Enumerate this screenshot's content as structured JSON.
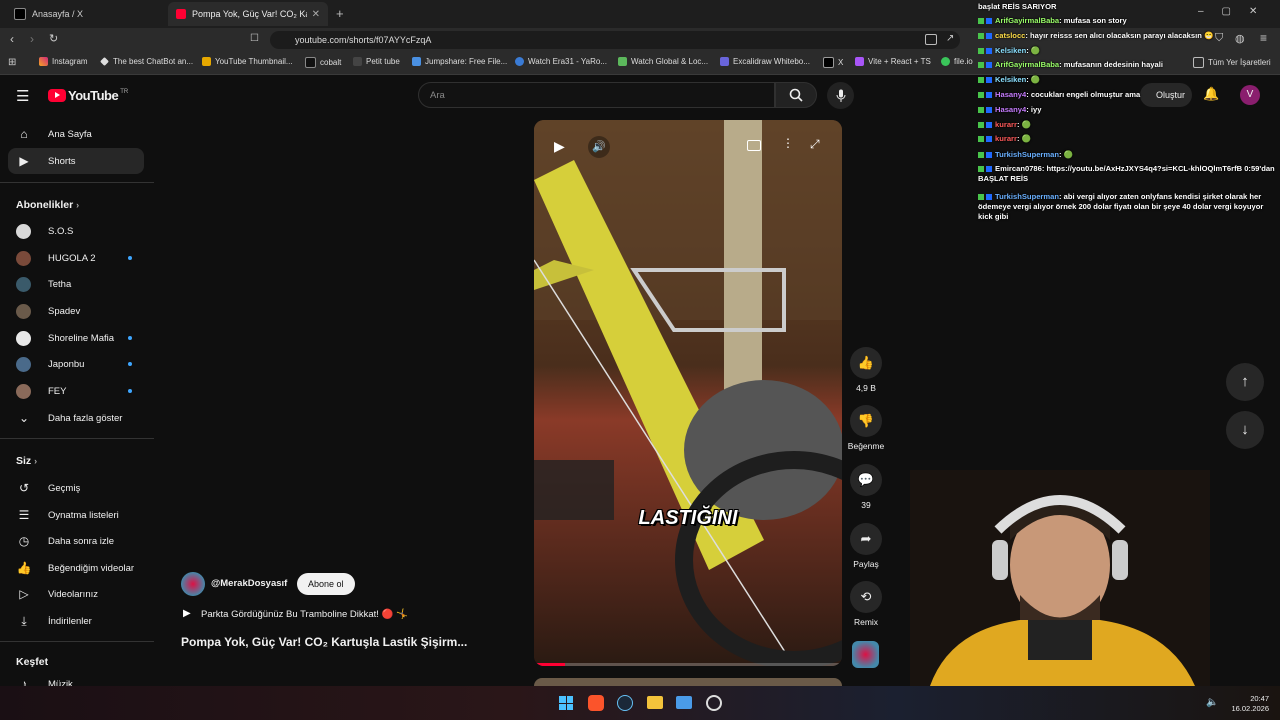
{
  "browser": {
    "tabs": [
      {
        "title": "Anasayfa / X"
      },
      {
        "title": "Pompa Yok, Güç Var! CO₂ Kart"
      }
    ],
    "url": "youtube.com/shorts/f07AYYcFzqA",
    "bookmarks": [
      "Instagram",
      "The best ChatBot an...",
      "YouTube Thumbnail...",
      "cobalt",
      "Petit tube",
      "Jumpshare: Free File...",
      "Watch Era31 - YaRo...",
      "Watch Global & Loc...",
      "Excalidraw Whitebo...",
      "X",
      "Vite + React + TS",
      "file.io"
    ],
    "bookmarks_all": "Tüm Yer İşaretleri"
  },
  "youtube": {
    "logo": "YouTube",
    "logo_region": "TR",
    "search_placeholder": "Ara",
    "create_label": "Oluştur",
    "avatar_letter": "V",
    "sidebar": {
      "main": [
        {
          "label": "Ana Sayfa",
          "icon": "home-icon"
        },
        {
          "label": "Shorts",
          "icon": "shorts-icon"
        }
      ],
      "subs_heading": "Abonelikler",
      "subs": [
        {
          "label": "S.O.S",
          "dot": false,
          "color": "#d8d8d8"
        },
        {
          "label": "HUGOLA 2",
          "dot": true,
          "color": "#7a4a3a"
        },
        {
          "label": "Tetha",
          "dot": false,
          "color": "#3a5a6a"
        },
        {
          "label": "Spadev",
          "dot": false,
          "color": "#6a5a4a"
        },
        {
          "label": "Shoreline Mafia",
          "dot": true,
          "color": "#e8e8e8"
        },
        {
          "label": "Japonbu",
          "dot": true,
          "color": "#4a6a8a"
        },
        {
          "label": "FEY",
          "dot": true,
          "color": "#8a6a5a"
        }
      ],
      "show_more": "Daha fazla göster",
      "you_heading": "Siz",
      "you": [
        {
          "label": "Geçmiş",
          "icon": "history-icon"
        },
        {
          "label": "Oynatma listeleri",
          "icon": "playlist-icon"
        },
        {
          "label": "Daha sonra izle",
          "icon": "clock-icon"
        },
        {
          "label": "Beğendiğim videolar",
          "icon": "thumb-up-icon"
        },
        {
          "label": "Videolarınız",
          "icon": "video-icon"
        },
        {
          "label": "İndirilenler",
          "icon": "download-icon"
        }
      ],
      "explore_heading": "Keşfet",
      "explore": [
        {
          "label": "Müzik"
        }
      ]
    },
    "short": {
      "channel": "@MerakDosyasıf",
      "subscribe": "Abone ol",
      "description": "Parkta Gördüğünüz Bu Tramboline Dikkat! 🔴 🤸",
      "title": "Pompa Yok, Güç Var! CO₂ Kartuşla Lastik Şişirm...",
      "caption": "LASTIĞINI",
      "progress_fraction": 0.1
    },
    "actions": {
      "likes": "4,9 B",
      "dislike": "Beğenme",
      "comments": "39",
      "share": "Paylaş",
      "remix": "Remix"
    }
  },
  "chat": [
    {
      "user": "",
      "text": "başlat REİS SARIYOR",
      "user_color": "#ffffff"
    },
    {
      "user": "ArifGayirmalBaba",
      "text": ": mufasa son story",
      "user_color": "#9bff6a"
    },
    {
      "user": "catslocc",
      "text": ": hayır reisss sen alıcı olacaksın parayı alacaksın 😁",
      "user_color": "#ffde4a"
    },
    {
      "user": "Kelsiken",
      "text": ": 🟢",
      "user_color": "#8be0ff"
    },
    {
      "user": "ArifGayirmalBaba",
      "text": ": mufasanın dedesinin hayali",
      "user_color": "#9bff6a"
    },
    {
      "user": "Kelsiken",
      "text": ": 🟢",
      "user_color": "#8be0ff"
    },
    {
      "user": "Hasany4",
      "text": ": cocukları engeli olmuştur ama",
      "user_color": "#c77dff"
    },
    {
      "user": "Hasany4",
      "text": ": iyy",
      "user_color": "#c77dff"
    },
    {
      "user": "kurarr",
      "text": ": 🟢",
      "user_color": "#ff5a5a"
    },
    {
      "user": "kurarr",
      "text": ": 🟢",
      "user_color": "#ff5a5a"
    },
    {
      "user": "TurkishSuperman",
      "text": ": 🟢",
      "user_color": "#6ab0ff"
    },
    {
      "user": "Emircan0786",
      "text": ": https://youtu.be/AxHzJXYS4q4?si=KCL-khlOQlmT6rfB 0:59'dan BAŞLAT REİS",
      "user_color": "#ffffff"
    },
    {
      "user": "TurkishSuperman",
      "text": ": abi vergi alıyor zaten onlyfans kendisi şirket olarak her ödemeye vergi alıyor örnek 200 dolar fiyatı olan bir şeye 40 dolar vergi koyuyor kick gibi",
      "user_color": "#6ab0ff"
    }
  ],
  "taskbar": {
    "time": "20:47",
    "date": "16.02.2026"
  }
}
